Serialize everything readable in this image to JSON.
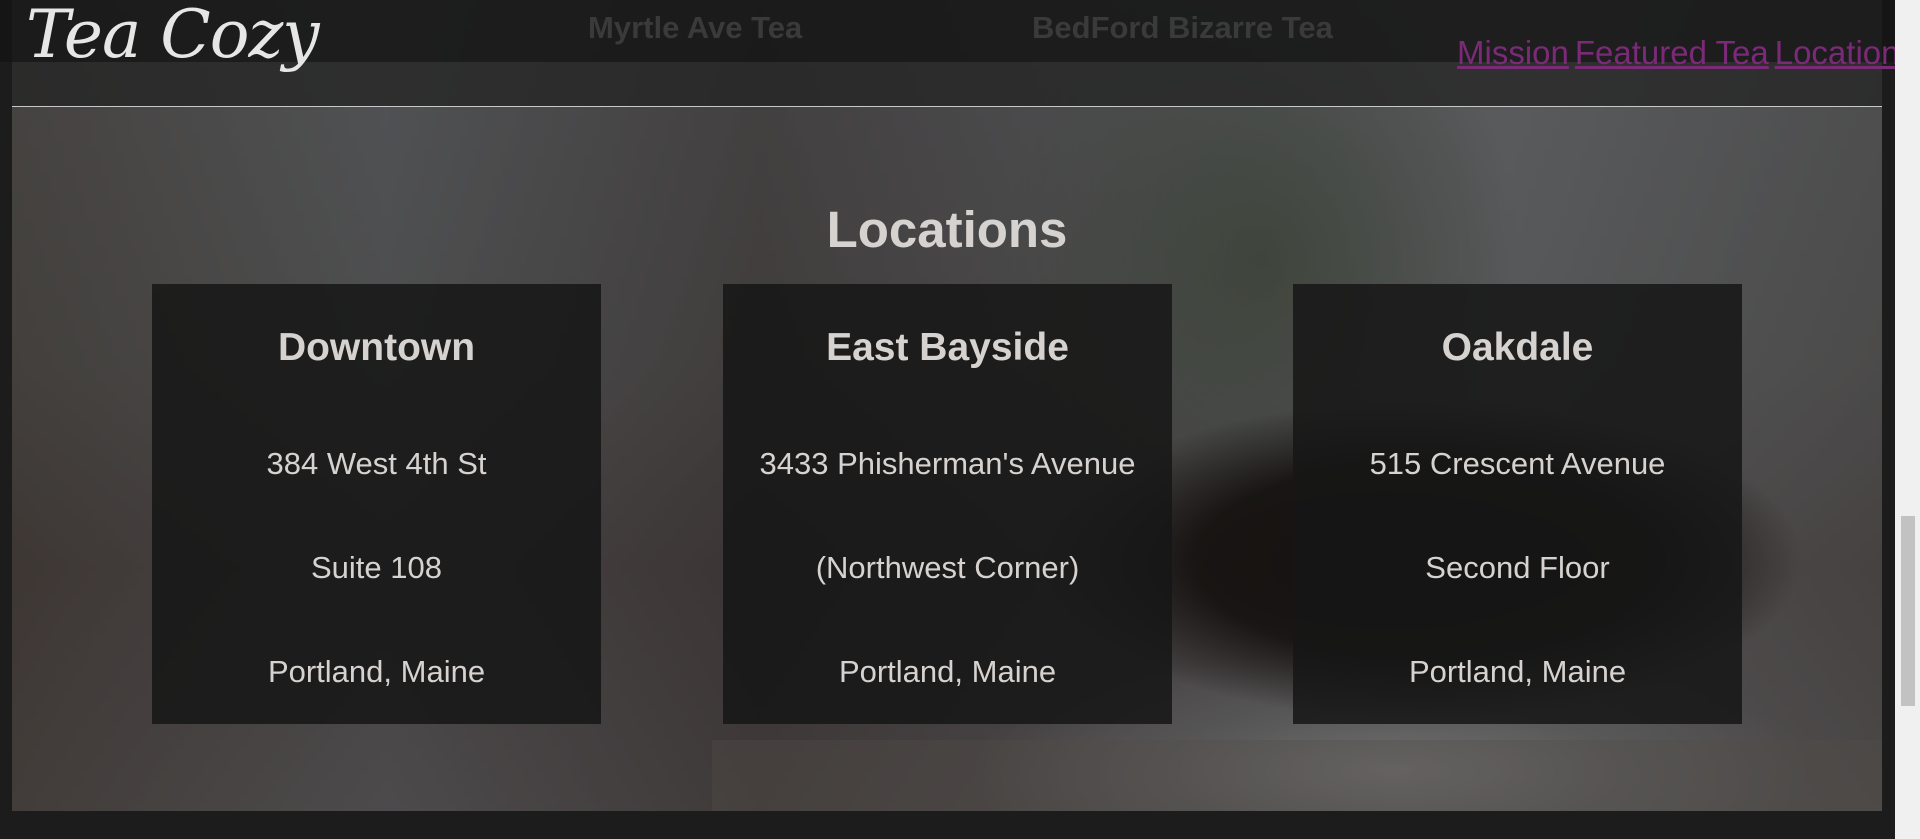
{
  "nav": {
    "logo": "Tea Cozy",
    "ghost_items": [
      "Myrtle Ave Tea",
      "BedFord Bizarre Tea"
    ],
    "links": [
      "Mission",
      "Featured Tea",
      "Locations"
    ],
    "link_color": "#7b2a78"
  },
  "locations": {
    "title": "Locations",
    "cards": [
      {
        "name": "Downtown",
        "lines": [
          "384 West 4th St",
          "Suite 108",
          "Portland, Maine"
        ]
      },
      {
        "name": "East Bayside",
        "lines": [
          "3433 Phisherman's Avenue",
          "(Northwest Corner)",
          "Portland, Maine"
        ]
      },
      {
        "name": "Oakdale",
        "lines": [
          "515 Crescent Avenue",
          "Second Floor",
          "Portland, Maine"
        ]
      }
    ]
  },
  "colors": {
    "text": "#d6d2cf",
    "card_bg": "#161616",
    "page_bg": "#1c1c1c"
  }
}
